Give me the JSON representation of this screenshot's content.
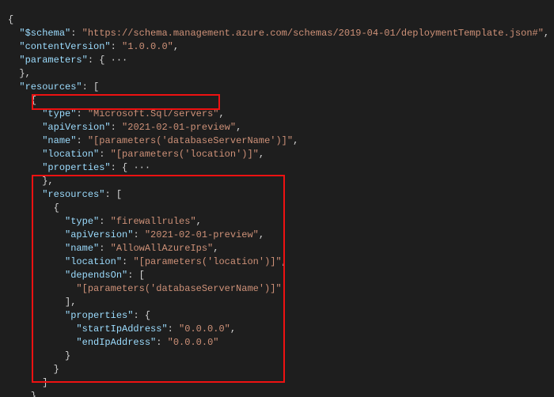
{
  "lines": {
    "l1_open": "{",
    "l2_k": "\"$schema\"",
    "l2_c": ": ",
    "l2_v": "\"https://schema.management.azure.com/schemas/2019-04-01/deploymentTemplate.json#\"",
    "l2_e": ",",
    "l3_k": "\"contentVersion\"",
    "l3_c": ": ",
    "l3_v": "\"1.0.0.0\"",
    "l3_e": ",",
    "l4_k": "\"parameters\"",
    "l4_c": ": {",
    "l4_d": " ···",
    "l5": "},",
    "l6_k": "\"resources\"",
    "l6_c": ": [",
    "l7_open": "{",
    "l8_k": "\"type\"",
    "l8_c": ": ",
    "l8_v": "\"Microsoft.Sql/servers\"",
    "l8_e": ",",
    "l9_k": "\"apiVersion\"",
    "l9_c": ": ",
    "l9_v": "\"2021-02-01-preview\"",
    "l9_e": ",",
    "l10_k": "\"name\"",
    "l10_c": ": ",
    "l10_v": "\"[parameters('databaseServerName')]\"",
    "l10_e": ",",
    "l11_k": "\"location\"",
    "l11_c": ": ",
    "l11_v": "\"[parameters('location')]\"",
    "l11_e": ",",
    "l12_k": "\"properties\"",
    "l12_c": ": {",
    "l12_d": " ···",
    "l13": "},",
    "l14_k": "\"resources\"",
    "l14_c": ": [",
    "l15_open": "{",
    "l16_k": "\"type\"",
    "l16_c": ": ",
    "l16_v": "\"firewallrules\"",
    "l16_e": ",",
    "l17_k": "\"apiVersion\"",
    "l17_c": ": ",
    "l17_v": "\"2021-02-01-preview\"",
    "l17_e": ",",
    "l18_k": "\"name\"",
    "l18_c": ": ",
    "l18_v": "\"AllowAllAzureIps\"",
    "l18_e": ",",
    "l19_k": "\"location\"",
    "l19_c": ": ",
    "l19_v": "\"[parameters('location')]\"",
    "l19_e": ",",
    "l20_k": "\"dependsOn\"",
    "l20_c": ": [",
    "l21_v": "\"[parameters('databaseServerName')]\"",
    "l22": "],",
    "l23_k": "\"properties\"",
    "l23_c": ": {",
    "l24_k": "\"startIpAddress\"",
    "l24_c": ": ",
    "l24_v": "\"0.0.0.0\"",
    "l24_e": ",",
    "l25_k": "\"endIpAddress\"",
    "l25_c": ": ",
    "l25_v": "\"0.0.0.0\"",
    "l26": "}",
    "l27": "}",
    "l28": "]",
    "l29": "},"
  }
}
